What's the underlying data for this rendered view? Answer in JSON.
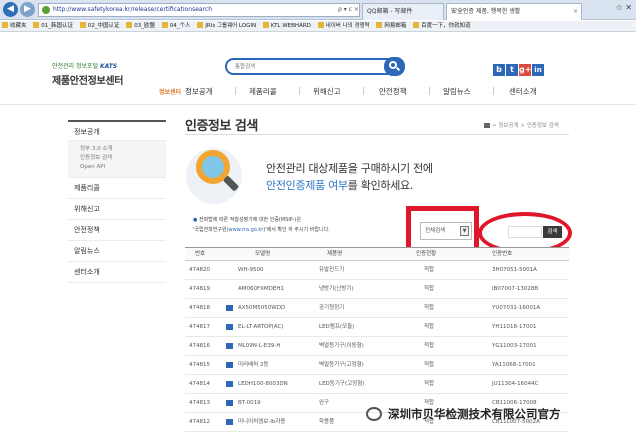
{
  "browser": {
    "address": "http://www.safetykorea.kr/release/certificationsearch",
    "address_ctrl": "ρ ▾ c ×",
    "tabs": [
      {
        "label": "QQ邮箱 - 写邮件"
      },
      {
        "label": "安全인증 제품, 행복한 생활"
      }
    ],
    "win_ctrl": "☆ ✕",
    "bookmarks": [
      "收藏夹",
      "01_韩国认证",
      "02_中国认证",
      "03_欧盟",
      "04_个人",
      "JRIs 그룹웨어 LOGIN",
      "KTL WEBHARD",
      "네이버 나의 경쟁력",
      "网易邮箱",
      "百度一下，你就知道"
    ]
  },
  "site": {
    "logo_top": "안전관리 정보포털",
    "logo_brand": "KATS",
    "logo_main": "제품안전정보센터",
    "search_placeholder": "통합검색",
    "sns": [
      "b",
      "t",
      "g+",
      "in"
    ],
    "gnb_home": "정보센터",
    "gnb": [
      "정보공개",
      "제품리콜",
      "위해신고",
      "안전정책",
      "알림뉴스",
      "센터소개"
    ]
  },
  "sidebar": {
    "sections": [
      {
        "label": "정보공개",
        "subitems": [
          "정부 3.0 소개",
          "인증정보 검색",
          "Open API"
        ]
      },
      {
        "label": "제품리콜"
      },
      {
        "label": "위해신고"
      },
      {
        "label": "안전정책"
      },
      {
        "label": "알림뉴스"
      },
      {
        "label": "센터소개"
      }
    ]
  },
  "content": {
    "title": "인증정보 검색",
    "breadcrumb": "> 정보공개 > 인증정보 검색",
    "hero_line1": "안전관리 대상제품을 구매하시기 전에",
    "hero_line2_highlight": "안전인증제품 여부",
    "hero_line2_rest": "를 확인하세요.",
    "notice_line1": "전파법에 따른 적합성평가에 대한 인증(MSIP-)은",
    "notice_line2_pre": "'국립전파연구원(",
    "notice_link": "www.rra.go.kr",
    "notice_line2_post": ")'에서 확인 하 주시기 바랍니다.",
    "select_value": "전체검색",
    "search_button": "검색"
  },
  "table": {
    "headers": [
      "번호",
      "모델명",
      "제품명",
      "인증현황",
      "인증번호"
    ],
    "rows": [
      {
        "no": "474820",
        "model": "WH-9500",
        "name": "유발진드기",
        "status": "적합",
        "cert": "3H07051-5001A",
        "img": false
      },
      {
        "no": "474819",
        "model": "AM060FXMDEH1",
        "name": "냉방기(난방기)",
        "status": "적합",
        "cert": "IB07007-13028B",
        "img": false
      },
      {
        "no": "474818",
        "model": "AX50M5050WDD",
        "name": "공기청정기",
        "status": "적합",
        "cert": "YU07031-16001A",
        "img": true
      },
      {
        "no": "474817",
        "model": "EL-LT-ARTOP(AC)",
        "name": "LED램프(모듈)",
        "status": "적합",
        "cert": "YH11018-17001",
        "img": true
      },
      {
        "no": "474816",
        "model": "ML09N-L-E39-H",
        "name": "벽멀등기구(이동형)",
        "status": "적합",
        "cert": "YG11003-17001",
        "img": true
      },
      {
        "no": "474815",
        "model": "미러배처 2등",
        "name": "벽멀등기구(고정형)",
        "status": "적합",
        "cert": "YA11068-17001",
        "img": true
      },
      {
        "no": "474814",
        "model": "LEDH100-8003DN",
        "name": "LED등기구(고정형)",
        "status": "적합",
        "cert": "JU11304-16044C",
        "img": true
      },
      {
        "no": "474813",
        "model": "BT-0019",
        "name": "완구",
        "status": "적합",
        "cert": "CB11006-17008",
        "img": true
      },
      {
        "no": "474812",
        "model": "미니어처엠보-lb자용",
        "name": "학용품",
        "status": "적합",
        "cert": "CB11L007-5002A",
        "img": true
      }
    ]
  },
  "watermark": "深圳市贝华检测技术有限公司官方"
}
